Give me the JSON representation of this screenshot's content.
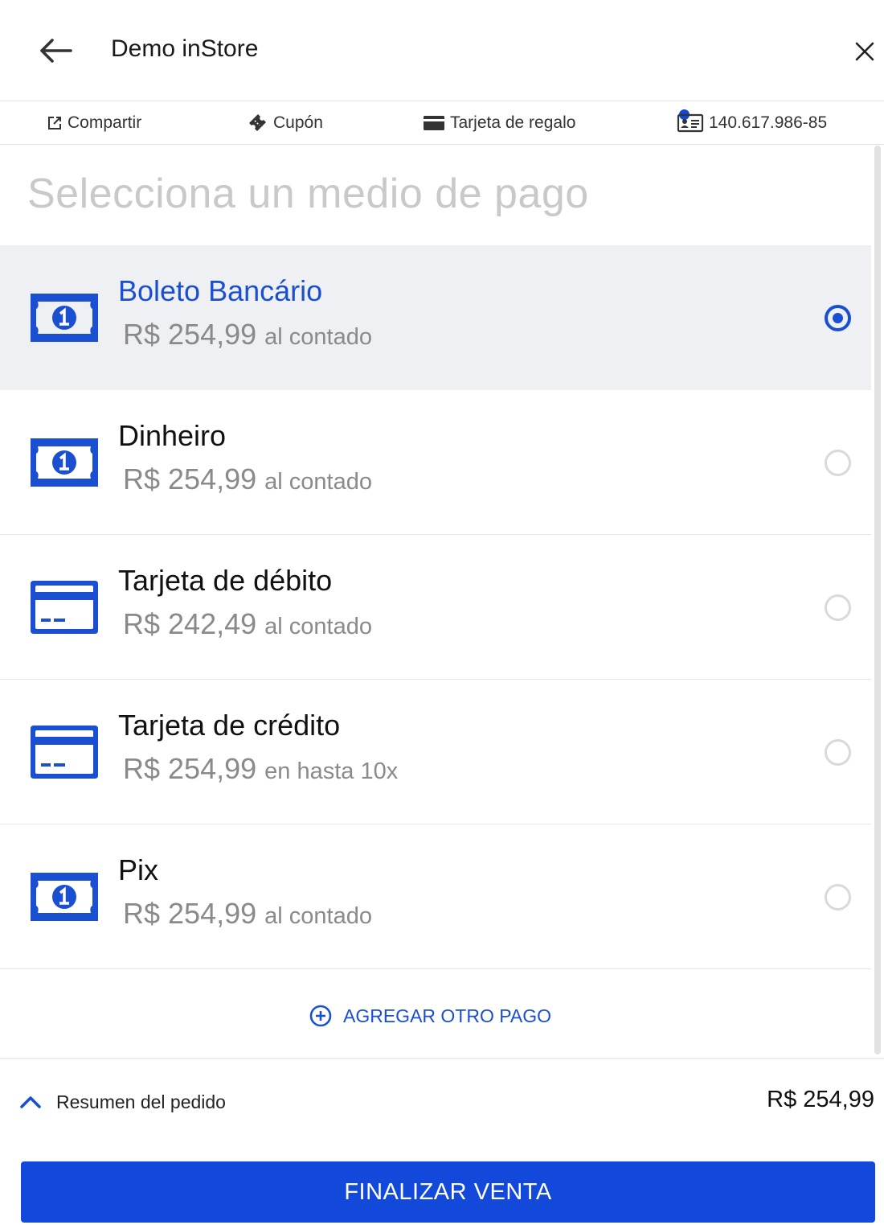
{
  "header": {
    "title": "Demo inStore",
    "back_icon": "arrow-left-icon",
    "close_icon": "close-icon"
  },
  "toolbar": {
    "share_label": "Compartir",
    "coupon_label": "Cupón",
    "gift_card_label": "Tarjeta de regalo",
    "client_id": "140.617.986-85"
  },
  "main": {
    "heading": "Selecciona un medio de pago",
    "methods": [
      {
        "name": "Boleto Bancário",
        "price": "R$ 254,99",
        "terms": "al contado",
        "icon": "cash-icon",
        "selected": true
      },
      {
        "name": "Dinheiro",
        "price": "R$ 254,99",
        "terms": "al contado",
        "icon": "cash-icon",
        "selected": false
      },
      {
        "name": "Tarjeta de débito",
        "price": "R$ 242,49",
        "terms": "al contado",
        "icon": "credit-card-icon",
        "selected": false
      },
      {
        "name": "Tarjeta de crédito",
        "price": "R$ 254,99",
        "terms": "en hasta 10x",
        "icon": "credit-card-icon",
        "selected": false
      },
      {
        "name": "Pix",
        "price": "R$ 254,99",
        "terms": "al contado",
        "icon": "cash-icon",
        "selected": false
      }
    ],
    "add_payment_label": "AGREGAR OTRO PAGO"
  },
  "footer": {
    "summary_label": "Resumen del pedido",
    "summary_total": "R$ 254,99",
    "finalize_label": "FINALIZAR VENTA"
  },
  "colors": {
    "accent": "#1a4fd2",
    "button": "#1349da",
    "selected_row": "#eef0f3",
    "muted_text": "#8a8a8a"
  }
}
